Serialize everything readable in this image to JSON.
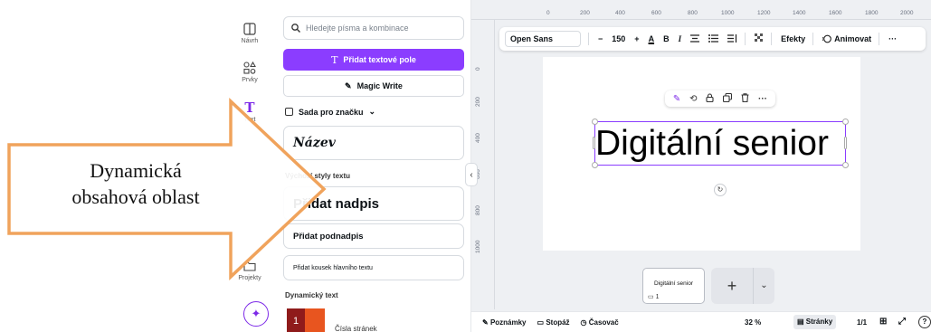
{
  "rail": {
    "items": [
      {
        "label": "Návrh",
        "icon": "layout-icon"
      },
      {
        "label": "Prvky",
        "icon": "shapes-icon"
      },
      {
        "label": "Text",
        "icon": "text-icon"
      },
      {
        "label": "Projekty",
        "icon": "folder-icon"
      }
    ],
    "magic_icon": "sparkle-icon"
  },
  "panel": {
    "search_placeholder": "Hledejte písma a kombinace",
    "add_textbox": "Přidat textové pole",
    "magic_write": "Magic Write",
    "brand_kit": "Sada pro značku",
    "brand_name_sample": "Název",
    "default_styles_label": "Výchozí styly textu",
    "add_heading": "Přidat nadpis",
    "add_subheading": "Přidat podnadpis",
    "add_body": "Přidat kousek hlavního textu",
    "dynamic_text_label": "Dynamický text",
    "page_numbers": "Čísla stránek"
  },
  "ruler": {
    "top": [
      "0",
      "200",
      "400",
      "600",
      "800",
      "1000",
      "1200",
      "1400",
      "1600",
      "1800",
      "2000"
    ],
    "left": [
      "0",
      "200",
      "400",
      "600",
      "800",
      "1000"
    ]
  },
  "toolbar": {
    "font": "Open Sans",
    "minus": "−",
    "size": "150",
    "plus": "+",
    "color_icon": "A",
    "bold": "B",
    "italic": "I",
    "effects": "Efekty",
    "animate": "Animovat",
    "more": "···"
  },
  "canvas": {
    "text": "Digitální senior"
  },
  "pages": {
    "thumb_label": "Digitální senior",
    "thumb_comments": "1",
    "add": "+"
  },
  "bottombar": {
    "notes": "Poznámky",
    "timing": "Stopáž",
    "timer": "Časovač",
    "zoom": "32 %",
    "pages": "Stránky",
    "page_count": "1/1",
    "help": "?"
  },
  "annotation": {
    "line1": "Dynamická",
    "line2": "obsahová oblast",
    "color": "#f0a35c"
  }
}
